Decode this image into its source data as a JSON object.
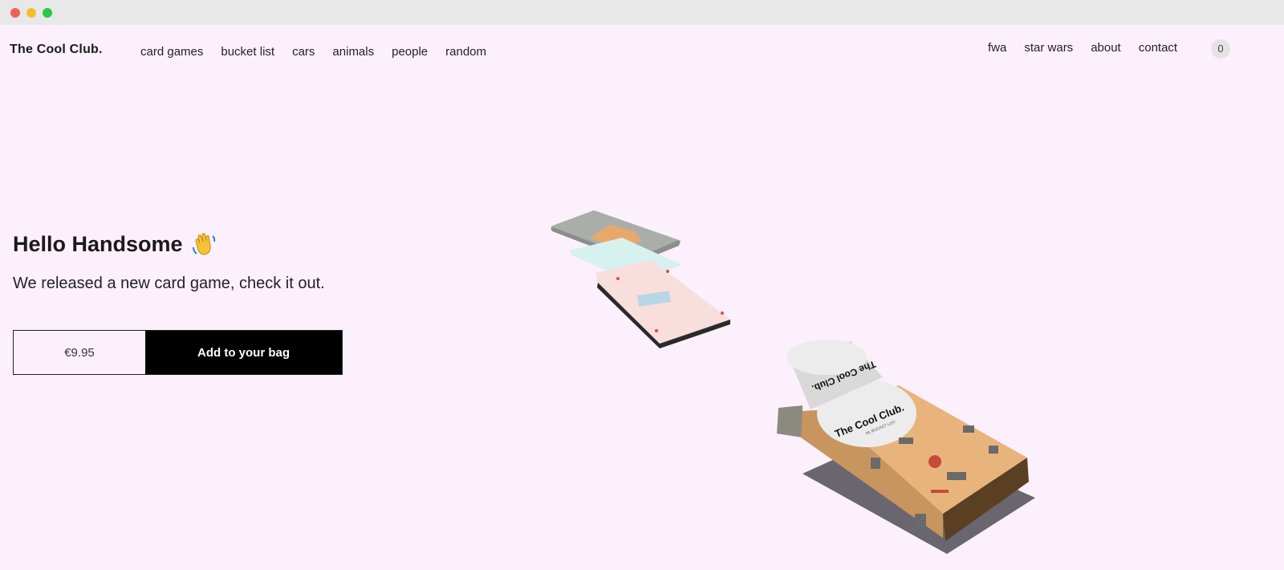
{
  "window": {
    "controls": {
      "close": "#f25f57",
      "minimize": "#f7bd2e",
      "maximize": "#28c840"
    }
  },
  "header": {
    "logo": "The Cool Club.",
    "nav_left": [
      "card games",
      "bucket list",
      "cars",
      "animals",
      "people",
      "random"
    ],
    "nav_right": [
      "fwa",
      "star wars",
      "about",
      "contact"
    ],
    "cart_count": "0"
  },
  "hero": {
    "title": "Hello Handsome",
    "title_icon": "waving-hand-icon",
    "subtitle": "We released a new card game, check it out.",
    "price": "€9.95",
    "cta": "Add to your bag"
  },
  "product_image": {
    "box_logo": "The Cool Club.",
    "box_subtitle": "NL BUCKET LIST"
  }
}
